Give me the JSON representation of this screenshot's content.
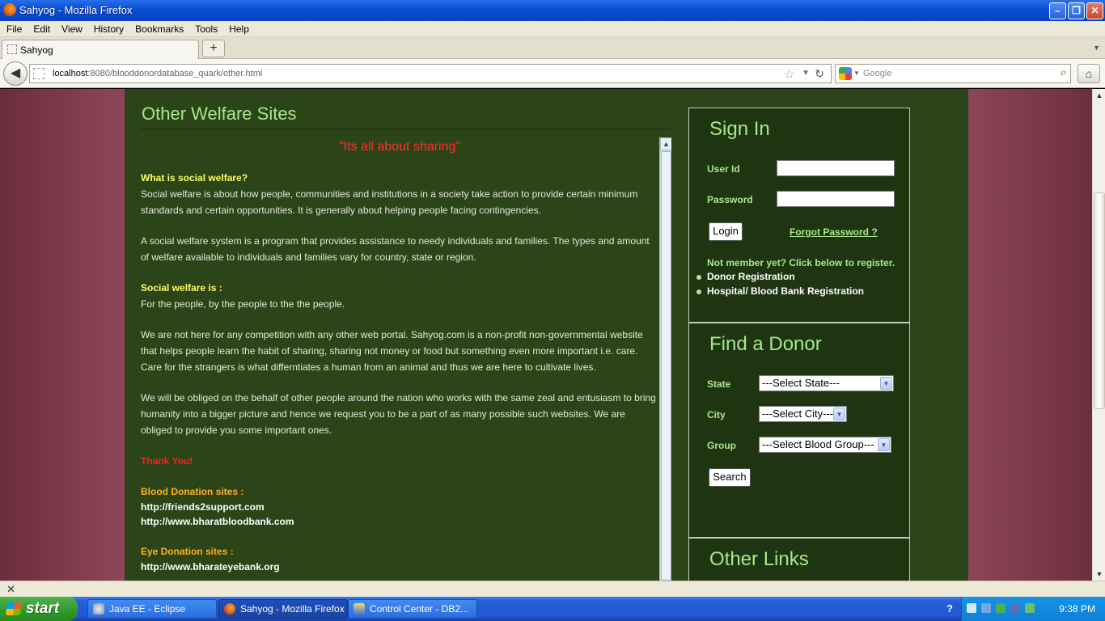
{
  "window": {
    "title": "Sahyog - Mozilla Firefox",
    "minimize": "–",
    "maximize": "❐",
    "close": "✕"
  },
  "menu": [
    "File",
    "Edit",
    "View",
    "History",
    "Bookmarks",
    "Tools",
    "Help"
  ],
  "tab": {
    "label": "Sahyog",
    "new_tab": "+",
    "overflow": "▼"
  },
  "nav": {
    "back": "◀",
    "url_host": "localhost",
    "url_path": ":8080/blooddonordatabase_quark/other.html",
    "bookmark_star": "☆",
    "dropdown": "▼",
    "reload": "↻",
    "search_placeholder": "Google",
    "search_icon": "⌕",
    "home": "⌂"
  },
  "page": {
    "section_title": "Other Welfare Sites",
    "tagline": "\"Its all about sharing\"",
    "q1": "What is social welfare?",
    "p1": "Social welfare is about how people, communities and institutions in a society take action to provide certain minimum standards and certain opportunities. It is generally about helping people facing contingencies.",
    "p2": "A social welfare system is a program that provides assistance to needy individuals and families. The types and amount of welfare available to individuals and families vary for country, state or region.",
    "q2": "Social welfare is :",
    "p3": "For the people, by the people to the the people.",
    "p4": "We are not here for any competition with any other web portal. Sahyog.com is a non-profit non-governmental website that helps people learn the habit of sharing, sharing not money or food but something even more important i.e. care. Care for the strangers is what differntiates a human from an animal and thus we are here to cultivate lives.",
    "p5": "We will be obliged on the behalf of other people around the nation who works with the same zeal and entusiasm to bring humanity into a bigger picture and hence we request you to be a part of as many possible such websites. We are obliged to provide you some important ones.",
    "thanks": "Thank You!",
    "blood_head": "Blood Donation sites :",
    "blood_links": [
      "http://friends2support.com",
      "http://www.bharatbloodbank.com"
    ],
    "eye_head": "Eye Donation sites :",
    "eye_links": [
      "http://www.bharateyebank.org"
    ]
  },
  "signin": {
    "title": "Sign In",
    "user_label": "User Id",
    "user_value": "",
    "password_label": "Password",
    "password_value": "",
    "login": "Login",
    "forgot": "Forgot Password ?",
    "not_member": "Not member yet? Click below to register.",
    "reg_links": [
      "Donor Registration",
      "Hospital/ Blood Bank Registration"
    ]
  },
  "find": {
    "title": "Find a Donor",
    "state_label": "State",
    "state_value": "---Select State---",
    "city_label": "City",
    "city_value": "---Select City---",
    "group_label": "Group",
    "group_value": "---Select Blood Group---",
    "search": "Search"
  },
  "other_links": {
    "title": "Other Links"
  },
  "status": {
    "close": "✕"
  },
  "taskbar": {
    "start": "start",
    "tasks": [
      "Java EE - Eclipse",
      "Sahyog - Mozilla Firefox",
      "Control Center - DB2..."
    ],
    "help": "?",
    "clock": "9:38 PM"
  },
  "colors": {
    "page_bg": "#2b4418",
    "sidebar_bg": "#1f3410",
    "accent_green": "#a8e88c",
    "quote_red": "#ff3030",
    "question_yellow": "#ffff60",
    "sites_orange": "#ffb020"
  }
}
